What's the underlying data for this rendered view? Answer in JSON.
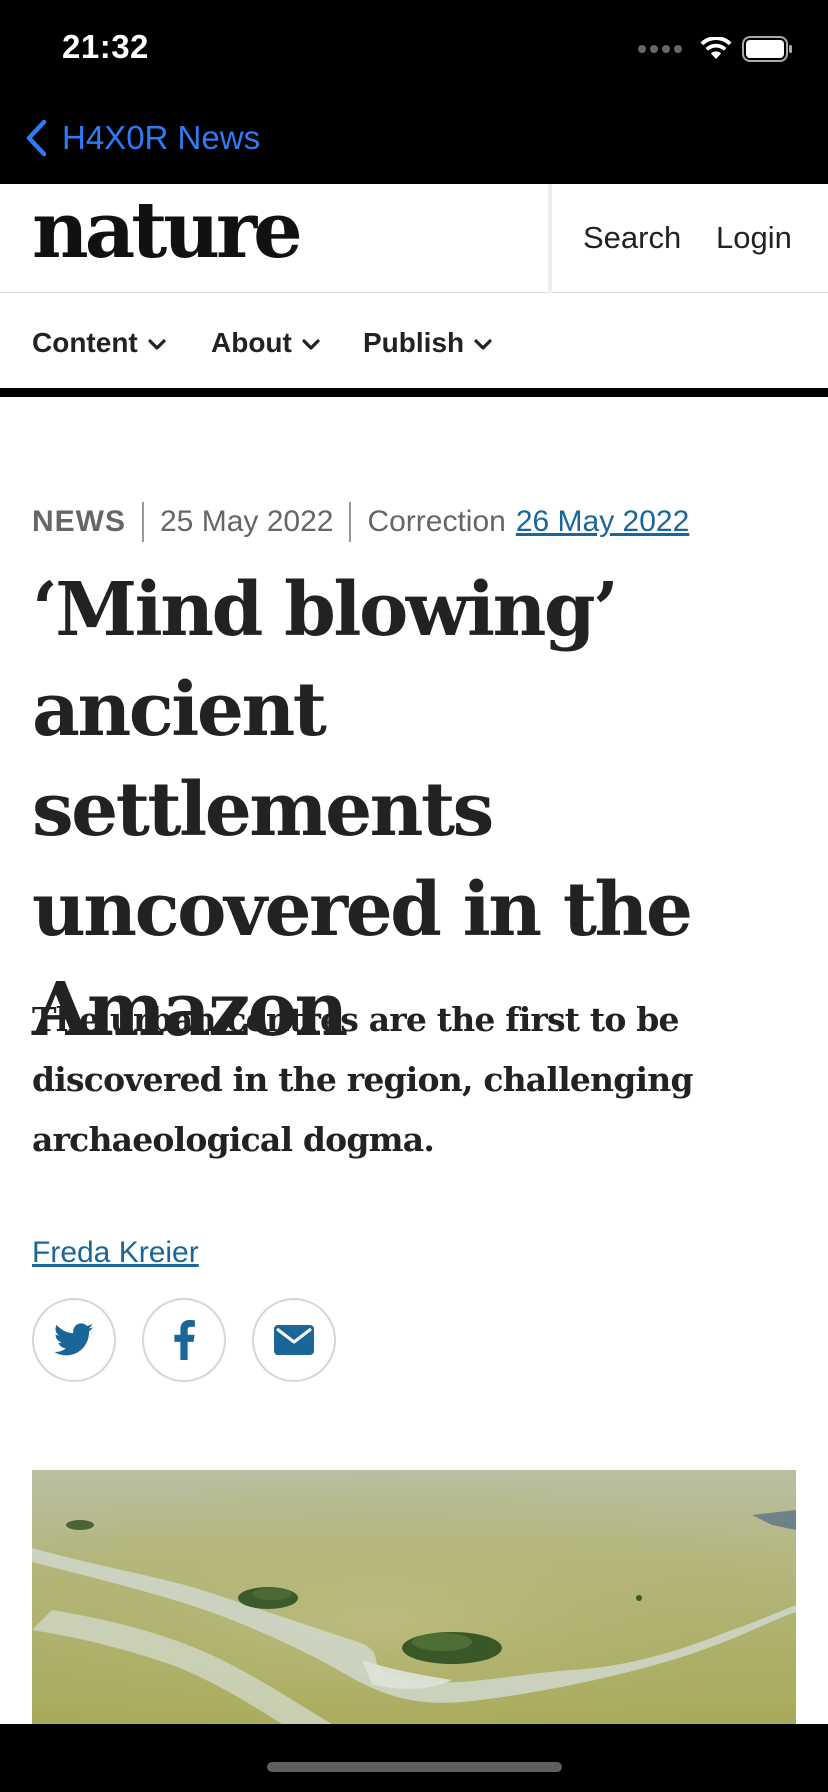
{
  "status_bar": {
    "time": "21:32"
  },
  "nav": {
    "back_label": "H4X0R News"
  },
  "site_header": {
    "logo": "nature",
    "search": "Search",
    "login": "Login"
  },
  "menu": {
    "items": [
      {
        "label": "Content"
      },
      {
        "label": "About"
      },
      {
        "label": "Publish"
      }
    ]
  },
  "article": {
    "type": "NEWS",
    "date": "25 May 2022",
    "correction_label": "Correction",
    "correction_date": "26 May 2022",
    "title": "‘Mind blowing’ ancient settlements uncovered in the Amazon",
    "standfirst": "The urban centres are the first to be discovered in the region, challenging archaeological dogma.",
    "author": "Freda Kreier"
  },
  "share": {
    "icons": [
      "twitter-icon",
      "facebook-icon",
      "email-icon"
    ]
  },
  "colors": {
    "link": "#1a6699",
    "ios_blue": "#2f7bf5",
    "text": "#222222"
  }
}
